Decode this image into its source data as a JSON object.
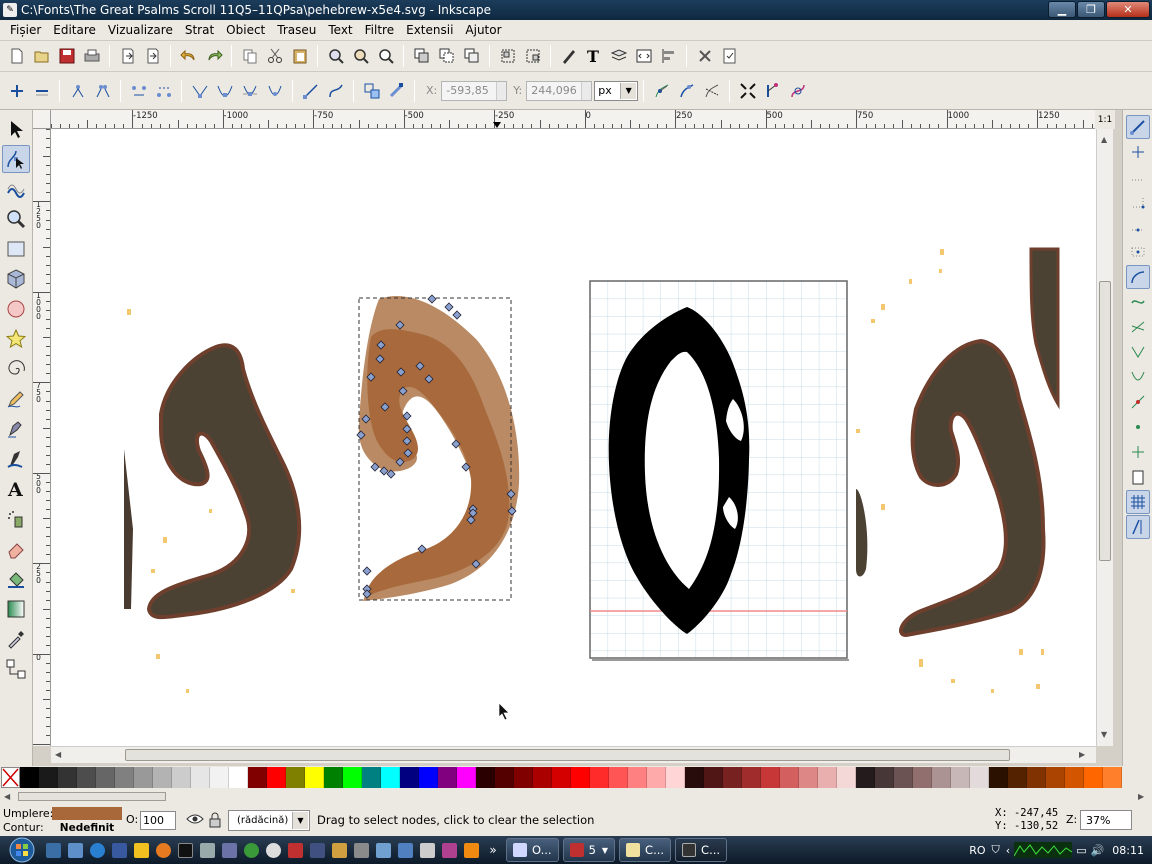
{
  "window": {
    "title": "C:\\Fonts\\The Great Psalms Scroll 11Q5–11QPsa\\pehebrew-x5e4.svg - Inkscape"
  },
  "menu": [
    "Fișier",
    "Editare",
    "Vizualizare",
    "Strat",
    "Obiect",
    "Traseu",
    "Text",
    "Filtre",
    "Extensii",
    "Ajutor"
  ],
  "controls": {
    "x_label": "X:",
    "x_value": "-593,85",
    "y_label": "Y:",
    "y_value": "244,096",
    "unit": "px"
  },
  "ruler": {
    "h_labels": [
      "-1250",
      "-1000",
      "-750",
      "-500",
      "-250",
      "0",
      "250",
      "500",
      "750",
      "1000",
      "1250"
    ],
    "v_labels": [
      "1250",
      "1000",
      "750",
      "500",
      "250",
      "0"
    ],
    "corner_button": "1:1"
  },
  "icons": {
    "tools": [
      "selector-tool-icon",
      "node-tool-icon",
      "tweak-tool-icon",
      "zoom-tool-icon",
      "rect-tool-icon",
      "3dbox-tool-icon",
      "ellipse-tool-icon",
      "star-tool-icon",
      "spiral-tool-icon",
      "pencil-tool-icon",
      "pen-tool-icon",
      "calligraphy-tool-icon",
      "text-tool-icon",
      "spray-tool-icon",
      "eraser-tool-icon",
      "paint-bucket-tool-icon",
      "gradient-tool-icon",
      "dropper-tool-icon",
      "connector-tool-icon"
    ],
    "active_tool": "node-tool-icon"
  },
  "palette": {
    "colors": [
      "#000000",
      "#1a1a1a",
      "#333333",
      "#4d4d4d",
      "#666666",
      "#808080",
      "#999999",
      "#b3b3b3",
      "#cccccc",
      "#e6e6e6",
      "#f2f2f2",
      "#ffffff",
      "#800000",
      "#ff0000",
      "#808000",
      "#ffff00",
      "#008000",
      "#00ff00",
      "#008080",
      "#00ffff",
      "#000080",
      "#0000ff",
      "#800080",
      "#ff00ff",
      "#2b0000",
      "#550000",
      "#800000",
      "#aa0000",
      "#d40000",
      "#ff0000",
      "#ff2a2a",
      "#ff5555",
      "#ff8080",
      "#ffaaaa",
      "#ffd5d5",
      "#280b0b",
      "#501616",
      "#782121",
      "#a02c2c",
      "#c83737",
      "#d35f5f",
      "#de8787",
      "#e9afaf",
      "#f4d7d7",
      "#241c1c",
      "#483737",
      "#6c5353",
      "#916f6f",
      "#ac9393",
      "#c8b7b7",
      "#e3dbdb",
      "#2b1100",
      "#552200",
      "#803300",
      "#aa4400",
      "#d45500",
      "#ff6600",
      "#ff7f2a"
    ]
  },
  "status": {
    "fill_label": "Umplere:",
    "stroke_label": "Contur:",
    "stroke_value": "Nedefinit",
    "fill_color": "#a8683a",
    "opacity_label": "O:",
    "opacity_value": "100",
    "layer": "(rădăcină)",
    "message": "Drag to select nodes, click to clear the selection",
    "x_readout": "X: -247,45",
    "y_readout": "Y: -130,52",
    "zoom_label": "Z:",
    "zoom_value": "37%"
  },
  "taskbar": {
    "tasks": [
      "O...",
      "5",
      "C...",
      "C..."
    ],
    "lang": "RO",
    "clock": "08:11"
  }
}
